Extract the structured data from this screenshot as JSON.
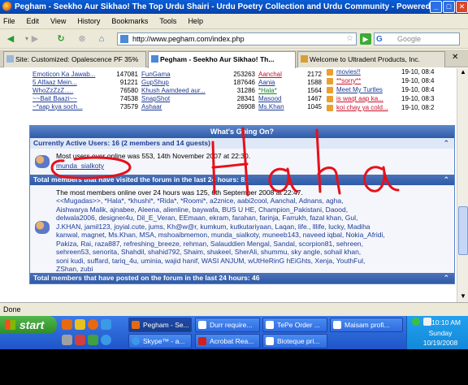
{
  "window": {
    "title": "Pegham - Seekho Aur Sikhao! The Top Urdu Shairi - Urdu Poetry Collection and Urdu Community - Powered by v",
    "controls": [
      "_",
      "□",
      "✕"
    ]
  },
  "menu": [
    "File",
    "Edit",
    "View",
    "History",
    "Bookmarks",
    "Tools",
    "Help"
  ],
  "nav": {
    "url": "http://www.pegham.com/index.php",
    "search_placeholder": "Google",
    "search_engine_letter": "G"
  },
  "tabs": [
    {
      "label": "Site: Customized: Opalescence PF 35%",
      "active": false
    },
    {
      "label": "Pegham - Seekho Aur Sikhao! Th...",
      "active": true
    },
    {
      "label": "Welcome to Ultradent Products, Inc.",
      "active": false
    }
  ],
  "stats_rows": [
    {
      "thread": "Emoticon Ka Jawab...",
      "views": "147081",
      "forum": "FunGama",
      "fviews": "253263",
      "user": "Aanchal",
      "count": "2172"
    },
    {
      "thread": "5 Alfaaz Mein...",
      "views": "91221",
      "forum": "GupShup",
      "fviews": "187646",
      "user": "Aania",
      "count": "1588"
    },
    {
      "thread": "WhoZzZzZ.....",
      "views": "76580",
      "forum": "Khush Aamdeed aur...",
      "fviews": "31286",
      "user": "*Hala*",
      "count": "1564"
    },
    {
      "thread": "~~Bait Baazi~~",
      "views": "74538",
      "forum": "SnapShot",
      "fviews": "28341",
      "user": "Masood",
      "count": "1467"
    },
    {
      "thread": "~*aap kya soch...",
      "views": "73579",
      "forum": "Ashaar",
      "fviews": "26908",
      "user": "Ms.Khan",
      "count": "1045"
    }
  ],
  "recent_threads": [
    {
      "title": "movies!!",
      "time": "19-10, 08:4"
    },
    {
      "title": "**sorry**",
      "time": "19-10, 08:4"
    },
    {
      "title": "Meet My Turtles",
      "time": "19-10, 08:4"
    },
    {
      "title": "is waqt aap ka...",
      "time": "19-10, 08:3"
    },
    {
      "title": "koi chay ya cold...",
      "time": "19-10, 08:2"
    }
  ],
  "whats_going_on": {
    "header": "What's Going On?",
    "active_users_title": "Currently Active Users: 16 (2 members and 14 guests)",
    "most_users_text": "Most users ever online was 553, 14th November 2007 at 22:30.",
    "active_member": "munda_sialkoty",
    "visited_24h_title": "Total members that have visited the forum in the last 24 hours: 81",
    "most_24h_text": "The most members online over 24 hours was 125, 6th September 2008 at 22:47.",
    "visited_users_html_lines": [
      "<<Mugadas>>, *Hala*, *khushi*, *Rida*, *Roomi*, a2znice, aabi2cool, Aanchal, Adnans, agha,",
      "Aishwarya Malik, ajnabee, Aleena, alienline, baywafa, BUS U HE, Champion_Pakistani, Daood,",
      "delwala2006, designer4u, Dil_E_Veran, EEmaan, ekram, farahan, farinja, Farrukh, fazal khan, Gul,",
      "J.KHAN, jamil123, joyial.cute, jums, Kh@w@r, kumkum, kutkutariyaan, Laqan, life., lllife, lucky, Madiha",
      "kanwal, magnet, Ms.Khan, MSA, mshoaibmemon, munda_sialkoty, muneeb143, naveed iqbal, Nokia_Afridi,",
      "Pakiza, Rai, raza887, refreshing_breeze, rehman, Salauddien Mengal, Sandal, scorpion81, sehreen,",
      "sehreen53, senorita, Shahdil, shahid792, Shaim, shakeel, SherAli, shummu, sky angle, sohail khan,",
      "soni kudi, suffard, tariq_4u, uminia, wajid hanif, WASI ANJUM, wUtHeRinG hEiGhts, Xenja, YouthFul,",
      "ZShan, zubi"
    ],
    "posted_24h_title": "Total members that have posted on the forum in the last 24 hours: 46"
  },
  "status_text": "Done",
  "taskbar": {
    "start_label": "start",
    "buttons_row1": [
      "Pegham - Se...",
      "Durr require...",
      "TePe Order ...",
      "Maisam profi..."
    ],
    "buttons_row2": [
      "Skype™ - a...",
      "Acrobat Rea...",
      "Bioteque pri..."
    ],
    "clock_time": "10:10 AM",
    "clock_day": "Sunday",
    "clock_date": "10/19/2008"
  },
  "annotation_text": "Haha",
  "colors": {
    "titlebar": "#0a5fd8",
    "link": "#1e3c96",
    "red_user": "#c8102e",
    "green_user": "#16852a",
    "panel_header": "#2e5aa8",
    "annotation": "#e8101a"
  }
}
